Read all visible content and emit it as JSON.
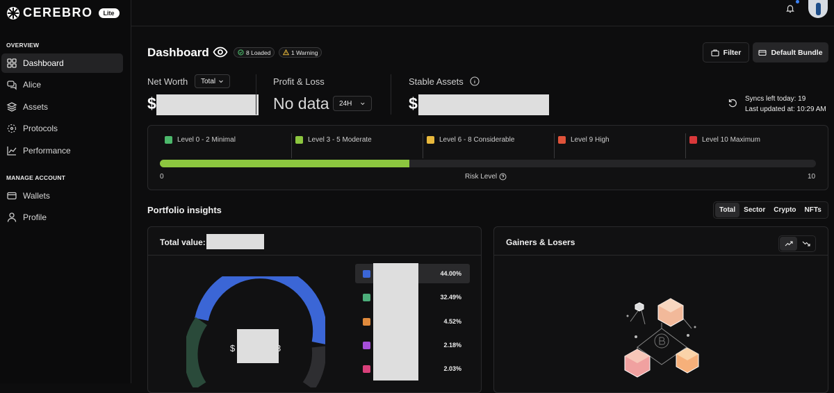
{
  "app": {
    "brand": "CEREBRO",
    "badge": "Lite"
  },
  "sidebar": {
    "sections": [
      {
        "label": "OVERVIEW",
        "items": [
          {
            "label": "Dashboard",
            "icon": "grid-icon",
            "active": true
          },
          {
            "label": "Alice",
            "icon": "chat-icon"
          },
          {
            "label": "Assets",
            "icon": "layers-icon"
          },
          {
            "label": "Protocols",
            "icon": "protocol-icon"
          },
          {
            "label": "Performance",
            "icon": "chart-line-icon"
          }
        ]
      },
      {
        "label": "MANAGE ACCOUNT",
        "items": [
          {
            "label": "Wallets",
            "icon": "wallet-icon"
          },
          {
            "label": "Profile",
            "icon": "user-icon"
          }
        ]
      }
    ]
  },
  "header": {
    "title": "Dashboard",
    "loaded_pill": "8 Loaded",
    "warning_pill": "1 Warning",
    "filter_label": "Filter",
    "bundle_label": "Default Bundle"
  },
  "stats": {
    "net_worth": {
      "label": "Net Worth",
      "select": "Total",
      "currency": "$"
    },
    "pnl": {
      "label": "Profit & Loss",
      "value": "No data",
      "select": "24H"
    },
    "stable": {
      "label": "Stable Assets",
      "currency": "$"
    },
    "sync": {
      "line1": "Syncs left today: 19",
      "line2": "Last updated at: 10:29 AM"
    }
  },
  "risk": {
    "levels": [
      {
        "label": "Level 0 - 2 Minimal",
        "color": "#4cb86b"
      },
      {
        "label": "Level 3 - 5 Moderate",
        "color": "#8cc63f"
      },
      {
        "label": "Level 6 - 8 Considerable",
        "color": "#e8b83c"
      },
      {
        "label": "Level 9 High",
        "color": "#e0533a"
      },
      {
        "label": "Level 10 Maximum",
        "color": "#d9383a"
      }
    ],
    "min": "0",
    "max": "10",
    "caption": "Risk Level",
    "value_fraction": 0.38
  },
  "insights": {
    "title": "Portfolio insights",
    "tabs": [
      "Total",
      "Sector",
      "Crypto",
      "NFTs"
    ],
    "active_tab": "Total",
    "total_value_label": "Total value: $",
    "center_prefix": "$",
    "center_suffix": "3"
  },
  "allocation": [
    {
      "color": "#3b66d6",
      "pct": "44.00%"
    },
    {
      "color": "#4cae7a",
      "pct": "32.49%"
    },
    {
      "color": "#e08a3c",
      "pct": "4.52%"
    },
    {
      "color": "#a64fd9",
      "pct": "2.18%"
    },
    {
      "color": "#d9407a",
      "pct": "2.03%"
    }
  ],
  "gainers": {
    "title": "Gainers & Losers"
  }
}
